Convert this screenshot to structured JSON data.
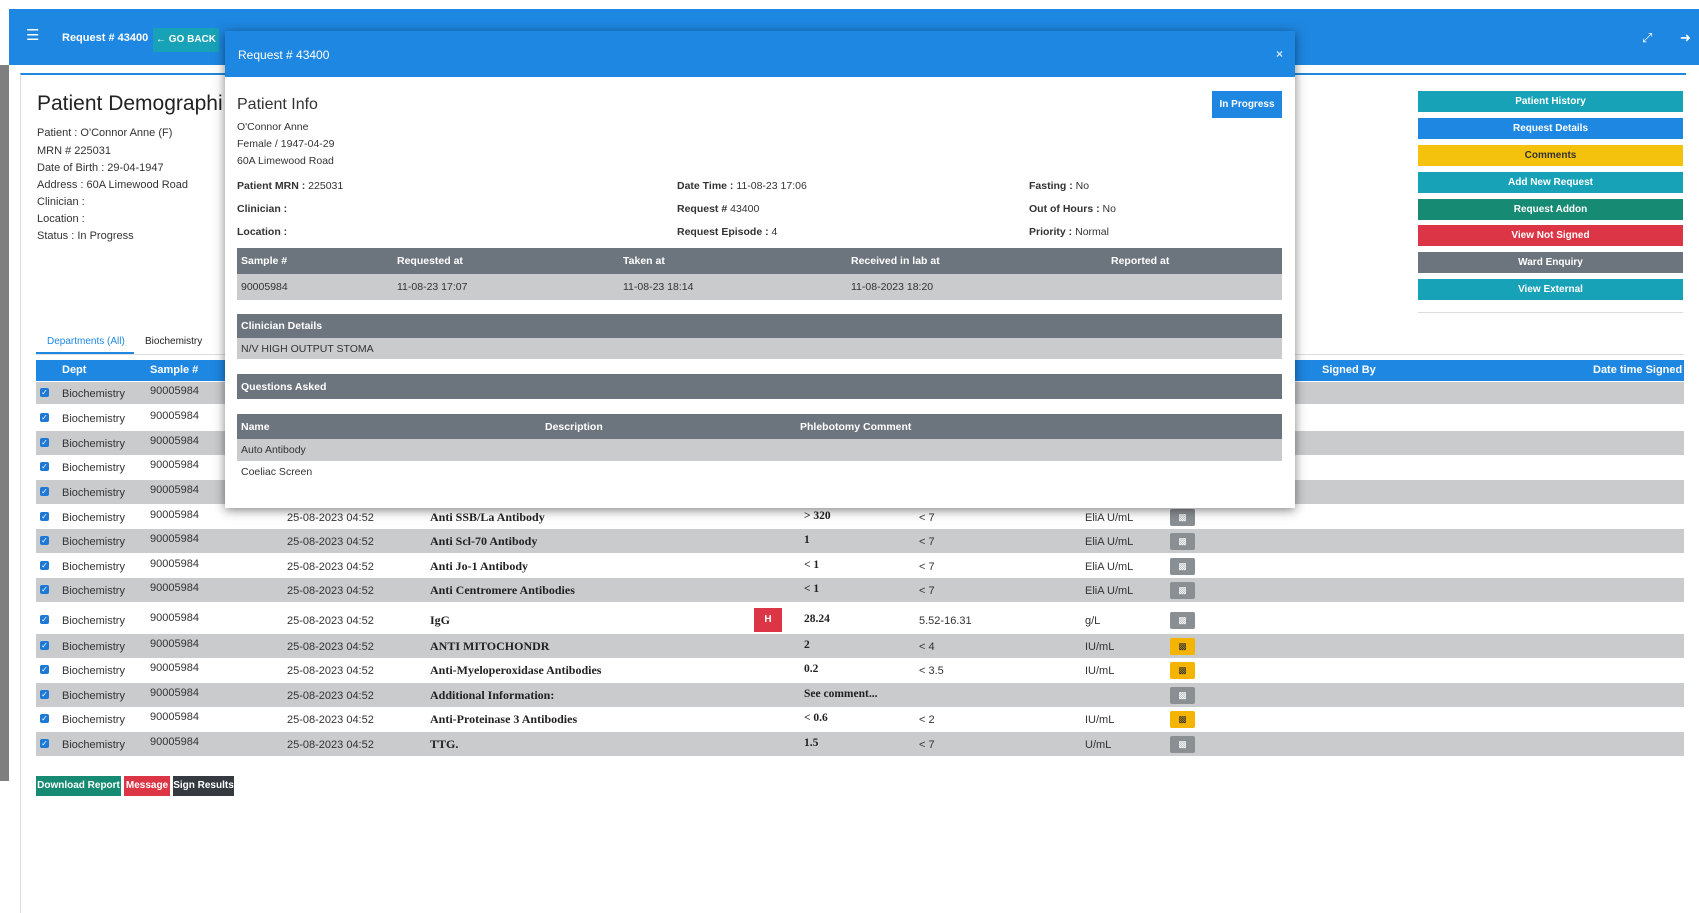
{
  "header": {
    "title": "Request # 43400",
    "go_back": "GO BACK",
    "menu_icon": "hamburger-icon",
    "expand_icon": "expand-icon",
    "logout_icon": "logout-icon"
  },
  "patient_demographics": {
    "title": "Patient Demographi",
    "lines": [
      "Patient : O'Connor Anne (F)",
      "MRN # 225031",
      "Date of Birth : 29-04-1947",
      "Address : 60A Limewood Road",
      "Clinician :",
      "Location :",
      "Status : In Progress"
    ]
  },
  "side_buttons": [
    {
      "label": "Patient History",
      "color": "#17a2b8"
    },
    {
      "label": "Request Details",
      "color": "#1e87e1"
    },
    {
      "label": "Comments",
      "color": "#f4c20d"
    },
    {
      "label": "Add New Request",
      "color": "#17a2b8"
    },
    {
      "label": "Request Addon",
      "color": "#168a73"
    },
    {
      "label": "View Not Signed",
      "color": "#dc3545"
    },
    {
      "label": "Ward Enquiry",
      "color": "#6c757d"
    },
    {
      "label": "View External",
      "color": "#17a2b8"
    }
  ],
  "tabs": [
    "Departments (All)",
    "Biochemistry"
  ],
  "results": {
    "headers": {
      "dept": "Dept",
      "sample": "Sample #",
      "signed_by": "Signed By",
      "date_signed": "Date time Signed"
    },
    "rows": [
      {
        "dept": "Biochemistry",
        "sample": "90005984",
        "date": "",
        "test": "",
        "flag": "",
        "value": "",
        "range": "",
        "unit": "",
        "lock": ""
      },
      {
        "dept": "Biochemistry",
        "sample": "90005984",
        "date": "",
        "test": "",
        "flag": "",
        "value": "",
        "range": "",
        "unit": "",
        "lock": ""
      },
      {
        "dept": "Biochemistry",
        "sample": "90005984",
        "date": "",
        "test": "",
        "flag": "",
        "value": "",
        "range": "",
        "unit": "",
        "lock": ""
      },
      {
        "dept": "Biochemistry",
        "sample": "90005984",
        "date": "",
        "test": "",
        "flag": "",
        "value": "",
        "range": "",
        "unit": "",
        "lock": ""
      },
      {
        "dept": "Biochemistry",
        "sample": "90005984",
        "date": "",
        "test": "",
        "flag": "",
        "value": "",
        "range": "",
        "unit": "",
        "lock": ""
      },
      {
        "dept": "Biochemistry",
        "sample": "90005984",
        "date": "25-08-2023 04:52",
        "test": "Anti SSB/La Antibody",
        "flag": "",
        "value": "> 320",
        "range": "< 7",
        "unit": "EliA U/mL",
        "lock": "gray"
      },
      {
        "dept": "Biochemistry",
        "sample": "90005984",
        "date": "25-08-2023 04:52",
        "test": "Anti Scl-70 Antibody",
        "flag": "",
        "value": "1",
        "range": "< 7",
        "unit": "EliA U/mL",
        "lock": "gray"
      },
      {
        "dept": "Biochemistry",
        "sample": "90005984",
        "date": "25-08-2023 04:52",
        "test": "Anti Jo-1 Antibody",
        "flag": "",
        "value": "< 1",
        "range": "< 7",
        "unit": "EliA U/mL",
        "lock": "gray"
      },
      {
        "dept": "Biochemistry",
        "sample": "90005984",
        "date": "25-08-2023 04:52",
        "test": "Anti Centromere Antibodies",
        "flag": "",
        "value": "< 1",
        "range": "< 7",
        "unit": "EliA U/mL",
        "lock": "gray"
      },
      {
        "dept": "Biochemistry",
        "sample": "90005984",
        "date": "25-08-2023 04:52",
        "test": "IgG",
        "flag": "H",
        "value": "28.24",
        "range": "5.52-16.31",
        "unit": "g/L",
        "lock": "gray"
      },
      {
        "dept": "Biochemistry",
        "sample": "90005984",
        "date": "25-08-2023 04:52",
        "test": "ANTI MITOCHONDR",
        "flag": "",
        "value": "2",
        "range": "< 4",
        "unit": "IU/mL",
        "lock": "yellow"
      },
      {
        "dept": "Biochemistry",
        "sample": "90005984",
        "date": "25-08-2023 04:52",
        "test": "Anti-Myeloperoxidase Antibodies",
        "flag": "",
        "value": "0.2",
        "range": "< 3.5",
        "unit": "IU/mL",
        "lock": "yellow"
      },
      {
        "dept": "Biochemistry",
        "sample": "90005984",
        "date": "25-08-2023 04:52",
        "test": "Additional Information:",
        "flag": "",
        "value": "See comment...",
        "range": "",
        "unit": "",
        "lock": "gray"
      },
      {
        "dept": "Biochemistry",
        "sample": "90005984",
        "date": "25-08-2023 04:52",
        "test": "Anti-Proteinase 3 Antibodies",
        "flag": "",
        "value": "< 0.6",
        "range": "< 2",
        "unit": "IU/mL",
        "lock": "yellow"
      },
      {
        "dept": "Biochemistry",
        "sample": "90005984",
        "date": "25-08-2023 04:52",
        "test": "TTG.",
        "flag": "",
        "value": "1.5",
        "range": "< 7",
        "unit": "U/mL",
        "lock": "gray"
      }
    ]
  },
  "bottom_buttons": [
    {
      "label": "Download Report",
      "color": "#168a73"
    },
    {
      "label": "Message",
      "color": "#dc3545"
    },
    {
      "label": "Sign Results",
      "color": "#343a40"
    }
  ],
  "modal": {
    "title": "Request # 43400",
    "close": "×",
    "section_title": "Patient Info",
    "status": "In Progress",
    "name": "O'Connor Anne",
    "gender_dob": "Female / 1947-04-29",
    "address": "60A Limewood Road",
    "fields": {
      "mrn_label": "Patient MRN :",
      "mrn_value": "225031",
      "clinician_label": "Clinician :",
      "clinician_value": "",
      "location_label": "Location :",
      "location_value": "",
      "datetime_label": "Date Time :",
      "datetime_value": "11-08-23 17:06",
      "request_label": "Request # ",
      "request_value": "43400",
      "episode_label": "Request Episode :",
      "episode_value": "4",
      "fasting_label": "Fasting :",
      "fasting_value": "No",
      "ooh_label": "Out of Hours :",
      "ooh_value": "No",
      "priority_label": "Priority :",
      "priority_value": "Normal"
    },
    "sample_table": {
      "headers": [
        "Sample #",
        "Requested at",
        "Taken at",
        "Received in lab at",
        "Reported at"
      ],
      "row": [
        "90005984",
        "11-08-23 17:07",
        "11-08-23 18:14",
        "11-08-2023 18:20",
        ""
      ]
    },
    "clinician_details": {
      "title": "Clinician Details",
      "text": "N/V HIGH OUTPUT STOMA"
    },
    "questions_asked": {
      "title": "Questions Asked"
    },
    "tests_table": {
      "headers": [
        "Name",
        "Description",
        "Phlebotomy Comment"
      ],
      "rows": [
        "Auto Antibody",
        "Coeliac Screen"
      ]
    }
  }
}
